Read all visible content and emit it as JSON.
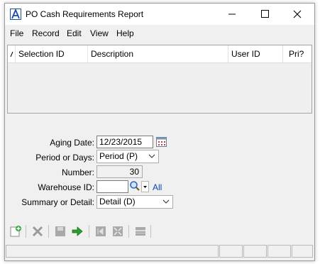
{
  "window": {
    "title": "PO Cash Requirements Report",
    "controls": {
      "minimize": "minimize",
      "maximize": "maximize",
      "close": "close"
    }
  },
  "menu": [
    "File",
    "Record",
    "Edit",
    "View",
    "Help"
  ],
  "grid": {
    "columns": [
      "Selection ID",
      "Description",
      "User ID",
      "Pri?"
    ],
    "rows": []
  },
  "form": {
    "aging_date_label": "Aging Date:",
    "aging_date_value": "12/23/2015",
    "period_label": "Period or Days:",
    "period_value": "Period (P)",
    "number_label": "Number:",
    "number_value": "30",
    "warehouse_label": "Warehouse ID:",
    "warehouse_value": "",
    "warehouse_all": "All",
    "summary_label": "Summary or Detail:",
    "summary_value": "Detail (D)"
  },
  "toolbar": [
    "new-record-icon",
    "delete-icon",
    "save-icon",
    "run-report-icon",
    "first-icon",
    "collapse-icon",
    "list-icon"
  ],
  "colors": {
    "accent": "#1a4da1",
    "link": "#0645ad",
    "run": "#2e9d2e"
  }
}
